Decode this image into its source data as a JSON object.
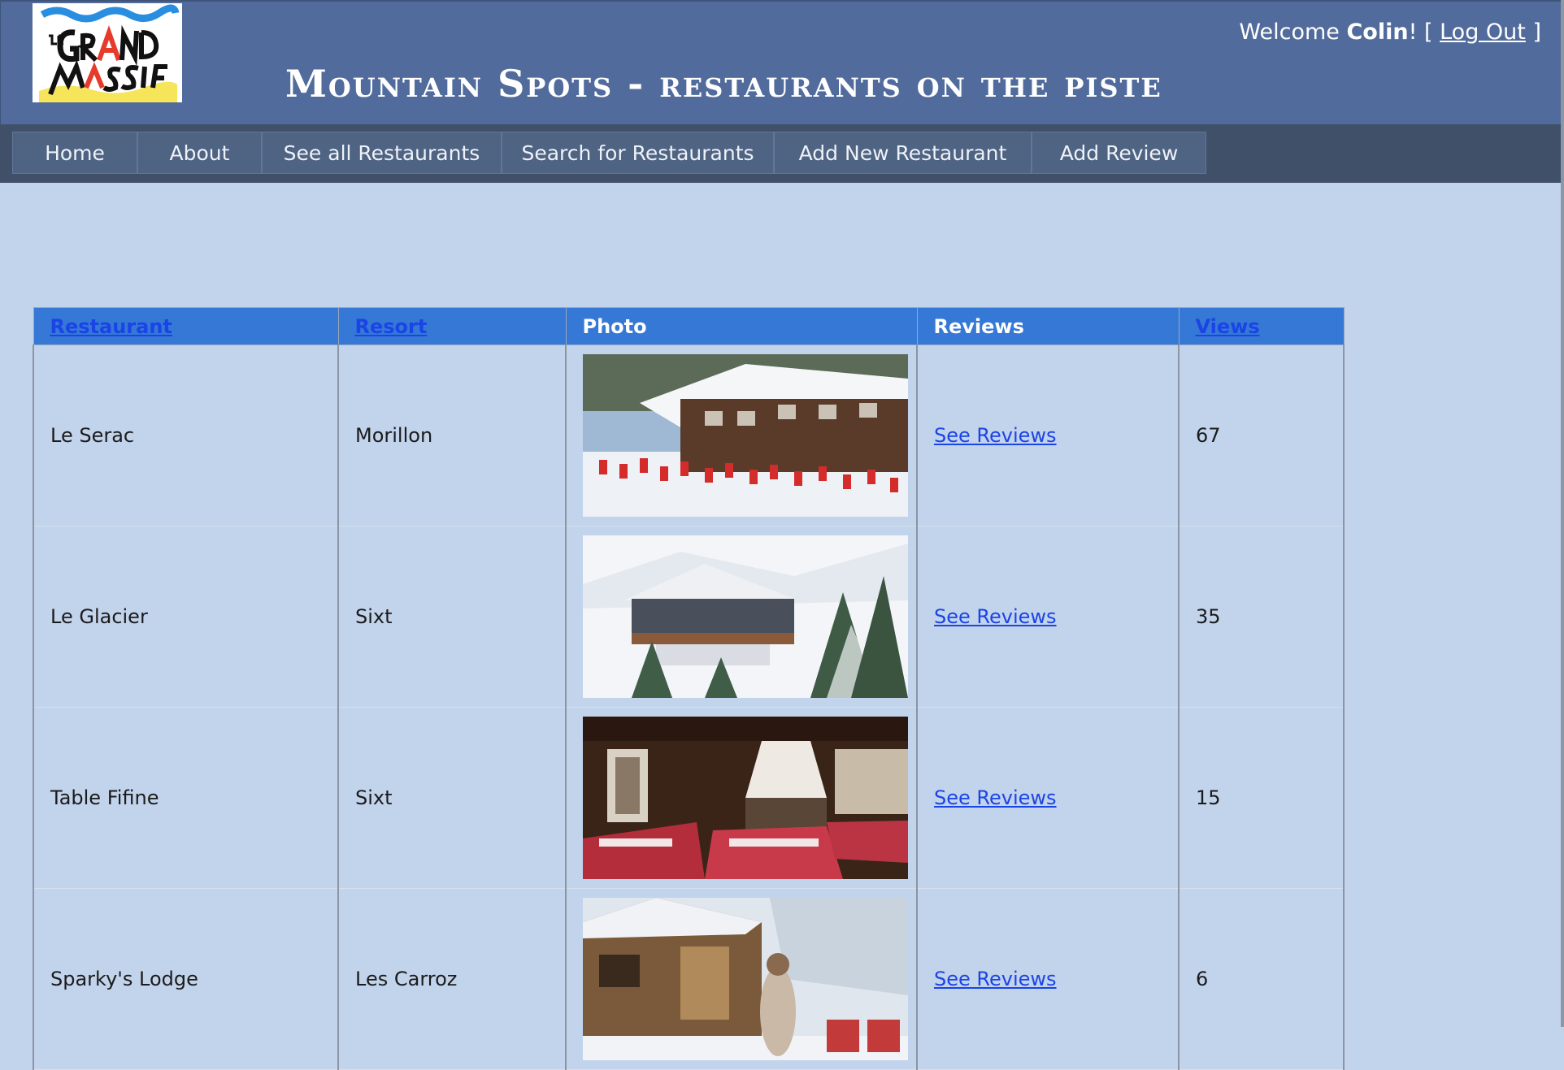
{
  "header": {
    "logo_text": "LE GRAND MASSIF",
    "title": "Mountain Spots  - restaurants on the piste",
    "welcome_prefix": "Welcome ",
    "user_name": "Colin",
    "welcome_middle": "! [ ",
    "logout_label": "Log Out",
    "welcome_suffix": " ]"
  },
  "nav": {
    "items": [
      {
        "label": "Home"
      },
      {
        "label": "About"
      },
      {
        "label": "See all Restaurants"
      },
      {
        "label": "Search for Restaurants"
      },
      {
        "label": "Add New Restaurant"
      },
      {
        "label": "Add Review"
      }
    ]
  },
  "table": {
    "headers": {
      "restaurant": "Restaurant",
      "resort": "Resort",
      "photo": "Photo",
      "reviews": "Reviews",
      "views": "Views"
    },
    "rows": [
      {
        "restaurant": "Le Serac",
        "resort": "Morillon",
        "reviews_link": "See Reviews",
        "views": "67",
        "photo_icon": "chalet-terrace-photo"
      },
      {
        "restaurant": "Le Glacier",
        "resort": "Sixt",
        "reviews_link": "See Reviews",
        "views": "35",
        "photo_icon": "snowy-chalet-photo"
      },
      {
        "restaurant": "Table Fifine",
        "resort": "Sixt",
        "reviews_link": "See Reviews",
        "views": "15",
        "photo_icon": "dining-room-photo"
      },
      {
        "restaurant": "Sparky's Lodge",
        "resort": "Les Carroz",
        "reviews_link": "See Reviews",
        "views": "6",
        "photo_icon": "lodge-skiers-photo"
      }
    ]
  },
  "colors": {
    "header_bg": "#516c9c",
    "nav_bg": "#3f5068",
    "page_bg": "#c2d3ec",
    "table_header_bg": "#3578d6",
    "link": "#1b44e6"
  }
}
